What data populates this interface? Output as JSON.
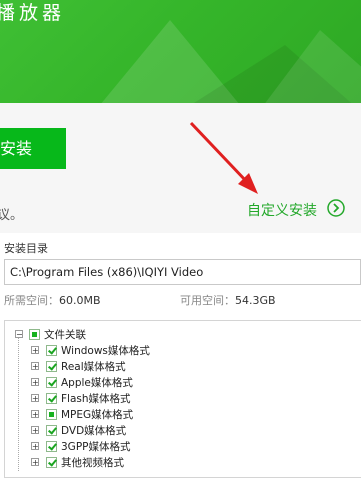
{
  "banner": {
    "title": "播放器"
  },
  "install": {
    "button_label": "安装",
    "agreement_text": "议。"
  },
  "custom_install": {
    "label": "自定义安装"
  },
  "directory": {
    "section_label": "安装目录",
    "path": "C:\\Program Files (x86)\\IQIYI Video"
  },
  "space": {
    "required_label": "所需空间：",
    "required_value": "60.0MB",
    "available_label": "可用空间：",
    "available_value": "54.3GB"
  },
  "tree": {
    "root": {
      "label": "文件关联",
      "state": "partial"
    },
    "items": [
      {
        "label": "Windows媒体格式",
        "state": "checked"
      },
      {
        "label": "Real媒体格式",
        "state": "checked"
      },
      {
        "label": "Apple媒体格式",
        "state": "checked"
      },
      {
        "label": "Flash媒体格式",
        "state": "checked"
      },
      {
        "label": "MPEG媒体格式",
        "state": "partial"
      },
      {
        "label": "DVD媒体格式",
        "state": "checked"
      },
      {
        "label": "3GPP媒体格式",
        "state": "checked"
      },
      {
        "label": "其他视频格式",
        "state": "checked"
      }
    ]
  },
  "colors": {
    "brand_green": "#3fbf34",
    "button_green": "#07b81a",
    "link_green": "#23a82a",
    "arrow_red": "#e02020"
  }
}
